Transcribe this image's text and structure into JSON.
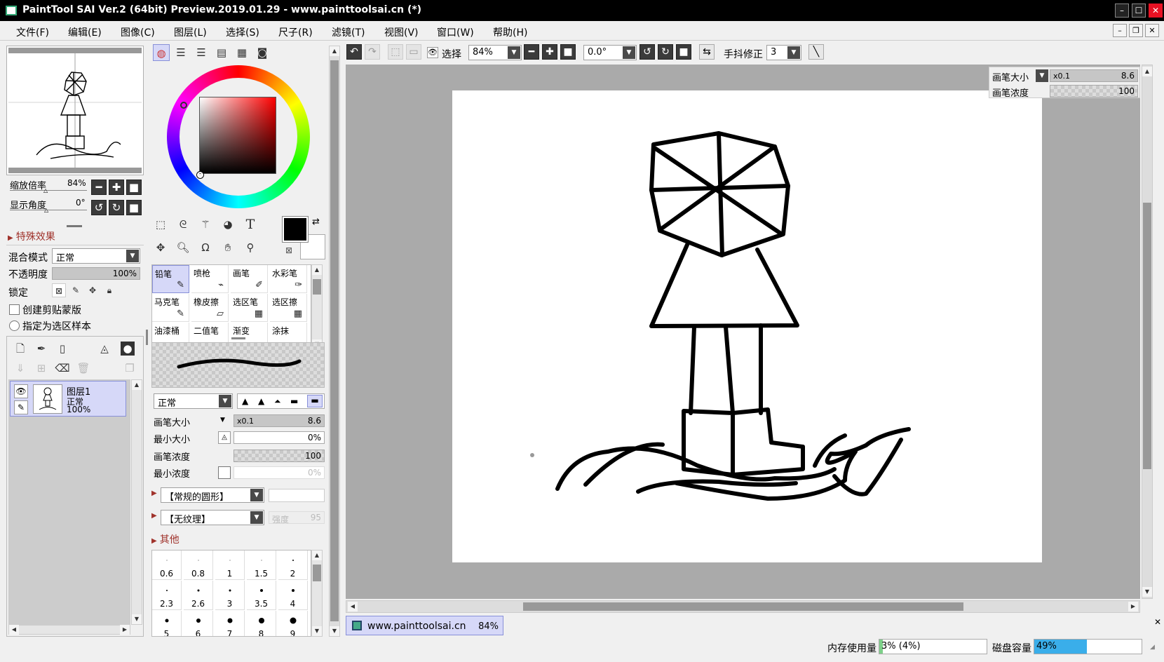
{
  "window": {
    "title": "PaintTool SAI Ver.2 (64bit) Preview.2019.01.29 - www.painttoolsai.cn (*)",
    "min_icon": "minimize-icon",
    "max_icon": "maximize-icon",
    "close_icon": "close-icon"
  },
  "menu": [
    "文件(F)",
    "编辑(E)",
    "图像(C)",
    "图层(L)",
    "选择(S)",
    "尺子(R)",
    "滤镜(T)",
    "视图(V)",
    "窗口(W)",
    "帮助(H)"
  ],
  "navigator": {
    "zoom_label": "缩放倍率",
    "zoom_value": "84%",
    "angle_label": "显示角度",
    "angle_value": "0°"
  },
  "layer_panel": {
    "effects_label": "特殊效果",
    "blend_label": "混合模式",
    "blend_value": "正常",
    "opacity_label": "不透明度",
    "opacity_value": "100%",
    "lock_label": "锁定",
    "clipping_label": "创建剪贴蒙版",
    "selection_source_label": "指定为选区样本",
    "layers": [
      {
        "name": "图层1",
        "mode": "正常",
        "opacity": "100%"
      }
    ]
  },
  "tools": {
    "list": [
      {
        "name": "铅笔",
        "icon": "pencil-icon",
        "glyph": "✎"
      },
      {
        "name": "喷枪",
        "icon": "airbrush-icon",
        "glyph": "⌁"
      },
      {
        "name": "画笔",
        "icon": "brush-icon",
        "glyph": "✐"
      },
      {
        "name": "水彩笔",
        "icon": "watercolor-icon",
        "glyph": "✑"
      },
      {
        "name": "马克笔",
        "icon": "marker-icon",
        "glyph": "✎"
      },
      {
        "name": "橡皮擦",
        "icon": "eraser-icon",
        "glyph": "▱"
      },
      {
        "name": "选区笔",
        "icon": "selection-pen-icon",
        "glyph": "▦"
      },
      {
        "name": "选区擦",
        "icon": "selection-eraser-icon",
        "glyph": "▦"
      },
      {
        "name": "油漆桶",
        "icon": "bucket-icon",
        "glyph": ""
      },
      {
        "name": "二值笔",
        "icon": "binary-pen-icon",
        "glyph": ""
      },
      {
        "name": "渐变",
        "icon": "gradient-icon",
        "glyph": ""
      },
      {
        "name": "涂抹",
        "icon": "smudge-icon",
        "glyph": ""
      }
    ],
    "blend_value": "正常",
    "brush_size_label": "画笔大小",
    "brush_size_mult": "x0.1",
    "brush_size_value": "8.6",
    "min_size_label": "最小大小",
    "min_size_value": "0%",
    "brush_density_label": "画笔浓度",
    "brush_density_value": "100",
    "min_density_label": "最小浓度",
    "min_density_value": "0%",
    "shape_value": "【常规的圆形】",
    "texture_value": "【无纹理】",
    "strength_label": "强度",
    "strength_value": "95",
    "other_label": "其他",
    "sizes": [
      "0.6",
      "0.8",
      "1",
      "1.5",
      "2",
      "2.3",
      "2.6",
      "3",
      "3.5",
      "4",
      "5",
      "6",
      "7",
      "8",
      "9"
    ],
    "dot_sizes": [
      1,
      1,
      1,
      1,
      2,
      2,
      3,
      3,
      4,
      4,
      5,
      6,
      7,
      8,
      9
    ]
  },
  "canvas_toolbar": {
    "select_label": "选择",
    "zoom_value": "84%",
    "angle_value": "0.0°",
    "stabilizer_label": "手抖修正",
    "stabilizer_value": "3"
  },
  "overlay": {
    "brush_size_label": "画笔大小",
    "brush_size_mult": "x0.1",
    "brush_size_value": "8.6",
    "brush_density_label": "画笔浓度",
    "brush_density_value": "100"
  },
  "document_tab": {
    "name": "www.painttoolsai.cn",
    "zoom": "84%"
  },
  "status": {
    "memory_label": "内存使用量",
    "memory_value": "3% (4%)",
    "memory_fraction": 0.03,
    "disk_label": "磁盘容量",
    "disk_value": "49%",
    "disk_fraction": 0.49
  },
  "colors": {
    "primary": "#000000",
    "secondary": "#ffffff",
    "accent": "#d6d8f8",
    "memory_bar": "#7ed08a",
    "disk_bar": "#3aaeea"
  }
}
